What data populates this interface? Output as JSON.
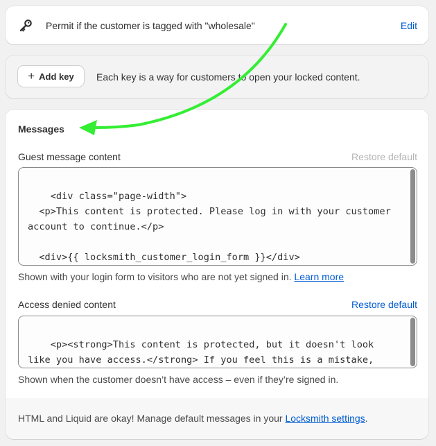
{
  "key_card": {
    "icon": "key-icon",
    "text": "Permit if the customer is tagged with \"wholesale\"",
    "edit_label": "Edit"
  },
  "add_key_card": {
    "button_label": "Add key",
    "button_icon": "plus-icon",
    "description": "Each key is a way for customers to open your locked content."
  },
  "messages": {
    "title": "Messages",
    "guest": {
      "label": "Guest message content",
      "restore_label": "Restore default",
      "content": "<div class=\"page-width\">\n  <p>This content is protected. Please log in with your customer account to continue.</p>\n\n  <div>{{ locksmith_customer_login_form }}</div>\n</div>",
      "help_text": "Shown with your login form to visitors who are not yet signed in.",
      "help_link": "Learn more"
    },
    "denied": {
      "label": "Access denied content",
      "restore_label": "Restore default",
      "content": "<p><strong>This content is protected, but it doesn't look like you have access.</strong> If you feel this is a mistake, please contact the store owner.</p>",
      "help_text": "Shown when the customer doesn’t have access – even if they’re signed in."
    },
    "footer": {
      "text_before": "HTML and Liquid are okay! Manage default messages in your",
      "link": "Locksmith settings",
      "text_after": "."
    }
  },
  "colors": {
    "link": "#005bd3",
    "annotation_arrow": "#33ee33",
    "disabled_text": "#b5b5b5"
  }
}
